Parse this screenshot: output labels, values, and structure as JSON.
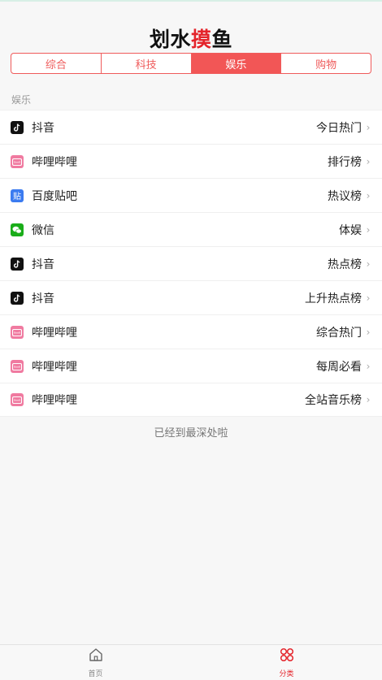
{
  "app": {
    "title_prefix": "划水",
    "title_highlight": "摸",
    "title_suffix": "鱼"
  },
  "tabs": [
    {
      "label": "综合",
      "active": false
    },
    {
      "label": "科技",
      "active": false
    },
    {
      "label": "娱乐",
      "active": true
    },
    {
      "label": "购物",
      "active": false
    }
  ],
  "section": {
    "label": "娱乐"
  },
  "items": [
    {
      "app": "抖音",
      "board": "今日热门",
      "icon": "douyin-icon"
    },
    {
      "app": "哔哩哔哩",
      "board": "排行榜",
      "icon": "bilibili-icon"
    },
    {
      "app": "百度贴吧",
      "board": "热议榜",
      "icon": "tieba-icon"
    },
    {
      "app": "微信",
      "board": "体娱",
      "icon": "wechat-icon"
    },
    {
      "app": "抖音",
      "board": "热点榜",
      "icon": "douyin-icon"
    },
    {
      "app": "抖音",
      "board": "上升热点榜",
      "icon": "douyin-icon"
    },
    {
      "app": "哔哩哔哩",
      "board": "综合热门",
      "icon": "bilibili-icon"
    },
    {
      "app": "哔哩哔哩",
      "board": "每周必看",
      "icon": "bilibili-icon"
    },
    {
      "app": "哔哩哔哩",
      "board": "全站音乐榜",
      "icon": "bilibili-icon"
    }
  ],
  "chevron": "›",
  "footer": {
    "end_text": "已经到最深处啦"
  },
  "tabbar": [
    {
      "label": "首页",
      "icon": "home-icon",
      "active": false
    },
    {
      "label": "分类",
      "icon": "category-icon",
      "active": true
    }
  ],
  "colors": {
    "accent": "#f25656",
    "title_highlight": "#e4242b",
    "douyin": "#111111",
    "bilibili": "#f07aa0",
    "tieba": "#3b7bf0",
    "wechat": "#1aad19"
  }
}
